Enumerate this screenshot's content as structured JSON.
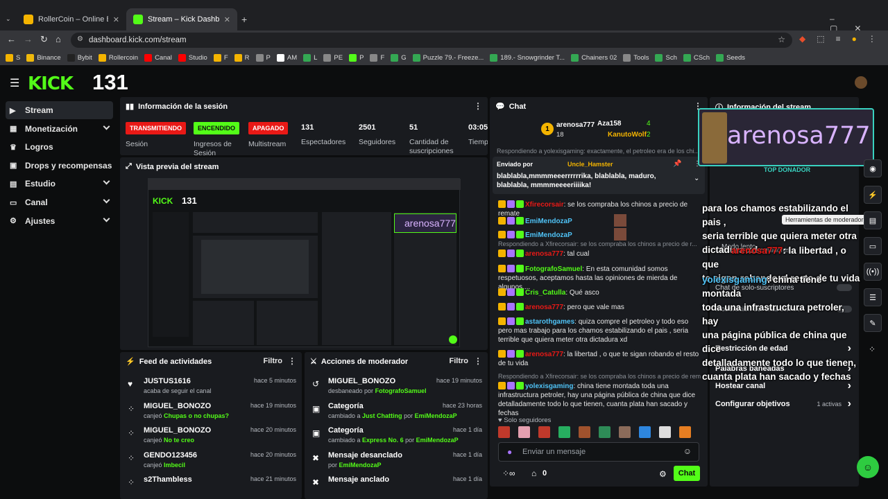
{
  "browser": {
    "tabs": [
      {
        "title": "RollerCoin – Online Bitcoin Mining",
        "active": false
      },
      {
        "title": "Stream – Kick Dashboard",
        "active": true
      }
    ],
    "url": "dashboard.kick.com/stream",
    "bookmarks": [
      "S",
      "Binance",
      "Bybit",
      "Rollercoin",
      "Canal",
      "Studio",
      "F",
      "R",
      "P",
      "AM",
      "L",
      "PE",
      "P",
      "F",
      "G",
      "Puzzle 79.- Freeze...",
      "189.- Snowgrinder T...",
      "Chainers 02",
      "Tools",
      "Sch",
      "CSch",
      "Seeds"
    ]
  },
  "app": {
    "logo": "KICK",
    "viewer_count": "131",
    "accent": "#53fc18"
  },
  "sidebar": {
    "items": [
      {
        "label": "Stream",
        "icon": "video-icon",
        "expandable": false
      },
      {
        "label": "Monetización",
        "icon": "money-icon",
        "expandable": true
      },
      {
        "label": "Logros",
        "icon": "trophy-icon",
        "expandable": false
      },
      {
        "label": "Drops y recompensas",
        "icon": "gift-icon",
        "expandable": false
      },
      {
        "label": "Estudio",
        "icon": "studio-icon",
        "expandable": true
      },
      {
        "label": "Canal",
        "icon": "channel-icon",
        "expandable": true
      },
      {
        "label": "Ajustes",
        "icon": "gear-icon",
        "expandable": true
      }
    ]
  },
  "session": {
    "title": "Información de la sesión",
    "badges": [
      {
        "label": "TRANSMITIENDO",
        "caption": "Sesión",
        "color": "#e91916"
      },
      {
        "label": "ENCENDIDO",
        "caption": "Ingresos de Sesión",
        "color": "#53fc18"
      },
      {
        "label": "APAGADO",
        "caption": "Multistream",
        "color": "#e91916"
      }
    ],
    "stats": [
      {
        "value": "131",
        "label": "Espectadores"
      },
      {
        "value": "2501",
        "label": "Seguidores"
      },
      {
        "value": "51",
        "label": "Cantidad de suscripciones"
      },
      {
        "value": "03:05:",
        "label": "Tiempo en vivo"
      }
    ]
  },
  "preview": {
    "title": "Vista previa del stream"
  },
  "activity": {
    "title": "Feed de actividades",
    "filter": "Filtro",
    "items": [
      {
        "icon": "heart-icon",
        "name": "JUSTUS1616",
        "time": "hace 5 minutos",
        "text": "acaba de seguir el canal",
        "highlight": ""
      },
      {
        "icon": "reward-icon",
        "name": "MIGUEL_BONOZO",
        "time": "hace 19 minutos",
        "text": "canjeó",
        "highlight": "Chupas o no chupas?"
      },
      {
        "icon": "reward-icon",
        "name": "MIGUEL_BONOZO",
        "time": "hace 20 minutos",
        "text": "canjeó",
        "highlight": "No te creo"
      },
      {
        "icon": "reward-icon",
        "name": "GENDO123456",
        "time": "hace 20 minutos",
        "text": "canjeó",
        "highlight": "Imbecil"
      },
      {
        "icon": "reward-icon",
        "name": "s2Thambless",
        "time": "hace 21 minutos",
        "text": "",
        "highlight": ""
      }
    ]
  },
  "modactions": {
    "title": "Acciones de moderador",
    "filter": "Filtro",
    "items": [
      {
        "icon": "undo-icon",
        "name": "MIGUEL_BONOZO",
        "time": "hace 19 minutos",
        "text": "desbaneado por",
        "highlight": "FotografoSamuel",
        "extra": "",
        "extra2": ""
      },
      {
        "icon": "category-icon",
        "name": "Categoría",
        "time": "hace 23 horas",
        "text": "cambiado a",
        "highlight": "Just Chatting",
        "extra": "por",
        "extra2": "EmiMendozaP"
      },
      {
        "icon": "category-icon",
        "name": "Categoría",
        "time": "hace 1 día",
        "text": "cambiado a",
        "highlight": "Express No. 6",
        "extra": "por",
        "extra2": "EmiMendozaP"
      },
      {
        "icon": "unpin-icon",
        "name": "Mensaje desanclado",
        "time": "hace 1 día",
        "text": "por",
        "highlight": "EmiMendozaP",
        "extra": "",
        "extra2": ""
      },
      {
        "icon": "pin-icon",
        "name": "Mensaje anclado",
        "time": "hace 1 día",
        "text": "",
        "highlight": "",
        "extra": "",
        "extra2": ""
      }
    ]
  },
  "chat": {
    "title": "Chat",
    "top": [
      {
        "rank": "1",
        "name": "arenosa777",
        "count": "18"
      },
      {
        "rank": "2",
        "name": "Aza158",
        "count": "4"
      },
      {
        "rank": "3",
        "name": "KanutoWolf",
        "count": "2"
      }
    ],
    "pinned": {
      "by_label": "Enviado por",
      "by": "Uncle_Hamster",
      "text": "blablabla,mmmmeeerrrrrrika, blablabla, maduro, blablabla, mmmmeeeeriiiika!"
    },
    "messages": [
      {
        "reply": "",
        "user": "Xfirecorsair",
        "color": "#e91916",
        "text": "se los compraba los chinos a precio de remate"
      },
      {
        "reply": "",
        "user": "EmiMendozaP",
        "color": "#4fc3f7",
        "text": ""
      },
      {
        "reply": "",
        "user": "EmiMendozaP",
        "color": "#4fc3f7",
        "text": ""
      },
      {
        "reply": "Respondiendo a Xfirecorsair: se los compraba los chinos a precio de r...",
        "user": "arenosa777",
        "color": "#e91916",
        "text": "tal cual"
      },
      {
        "reply": "",
        "user": "FotografoSamuel",
        "color": "#53fc18",
        "text": "En esta comunidad somos respetuosos, aceptamos hasta las opiniones de mierda de algunos...."
      },
      {
        "reply": "",
        "user": "Cris_Catulla",
        "color": "#53fc18",
        "text": "Qué asco"
      },
      {
        "reply": "",
        "user": "arenosa777",
        "color": "#e91916",
        "text": "pero que vale mas"
      },
      {
        "reply": "",
        "user": "astarothgames",
        "color": "#4fc3f7",
        "text": "quiza compre el petroleo y todo eso pero mas trabajo para los chamos estabilizando el pais , seria terrible que quiera meter otra dictadura xd"
      },
      {
        "reply": "",
        "user": "arenosa777",
        "color": "#e91916",
        "text": "la libertad , o que te sigan robando el resto de tu vida"
      },
      {
        "reply": "Respondiendo a Xfirecorsair: se los compraba los chinos a precio de rem...",
        "user": "yolexisgaming",
        "color": "#4fc3f7",
        "text": "china tiene montada toda una infrastructura petroler, hay una página pública de china que dice detalladamente todo lo que tienen, cuanta plata han sacado y fechas"
      }
    ],
    "reply_top": "Respondiendo a yolexisgaming: exactamente, el petroleo era de los chi...",
    "followers_only": "Solo seguidores",
    "input_placeholder": "Enviar un mensaje",
    "send_label": "Chat",
    "count": "0"
  },
  "overlay": {
    "donor_name": "arenosa777",
    "donor_label": "TOP DONADOR",
    "lines": [
      "para los chamos estabilizando el pais ,",
      "seria terrible que quiera meter otra",
      "dictadura xd"
    ],
    "msg2_user": "arenosa777",
    "msg2_text": ": la libertad , o que",
    "msg2_line2": "te sigan robando el resto de tu vida",
    "msg3_user": "yolexisgaming",
    "msg3_text": ": china tiene montada",
    "msg3_lines": [
      "toda una infrastructura petroler, hay",
      "una página pública de china que dice",
      "detalladamente todo lo que tienen,",
      "cuanta plata han sacado y fechas"
    ],
    "tooltip": "Herramientas de moderador"
  },
  "info": {
    "title": "Información del stream",
    "faded": [
      "Chat de solo-seguidores",
      "Modo lento",
      "Chat de solo-suscriptores",
      "Moderación del chat con IA"
    ],
    "items": [
      {
        "label": "Restricción de edad",
        "extra": ""
      },
      {
        "label": "Palabras baneadas",
        "extra": ""
      },
      {
        "label": "Hostear canal",
        "extra": ""
      },
      {
        "label": "Configurar objetivos",
        "extra": "1 activas"
      }
    ]
  }
}
